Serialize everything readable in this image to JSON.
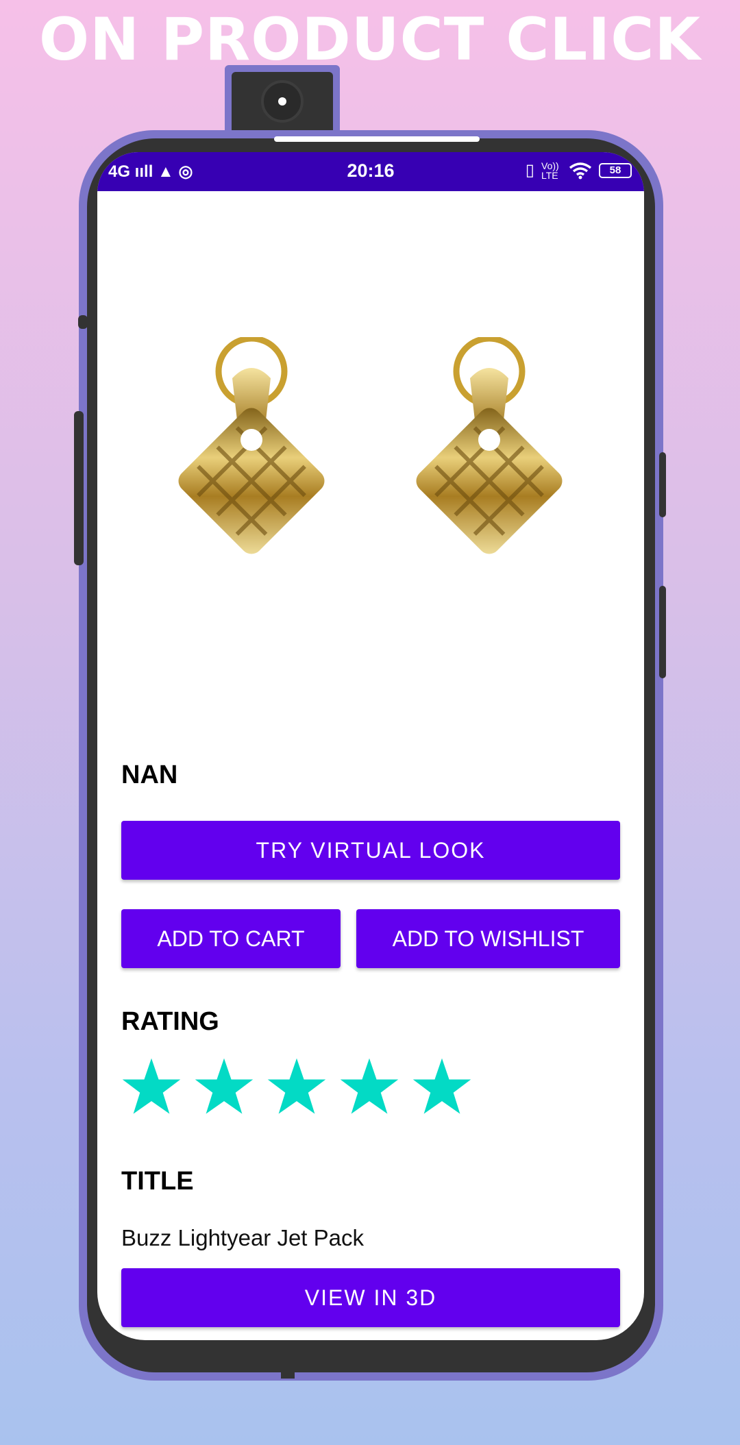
{
  "banner": "ON PRODUCT CLICK",
  "status_bar": {
    "left": "4G ııll ▲ ◎",
    "time": "20:16",
    "network": "Vo)) LTE",
    "battery": "58"
  },
  "product": {
    "name": "NAN",
    "try_button": "TRY VIRTUAL LOOK",
    "add_cart_button": "ADD TO CART",
    "add_wishlist_button": "ADD TO WISHLIST",
    "rating_label": "RATING",
    "rating": 5,
    "rating_max": 5,
    "star_color": "#03dac5",
    "title_label": "TITLE",
    "title": "Buzz Lightyear Jet Pack",
    "view3d_button": "VIEW IN 3D"
  },
  "colors": {
    "primary": "#6200ee",
    "status_bar": "#3700b3"
  }
}
